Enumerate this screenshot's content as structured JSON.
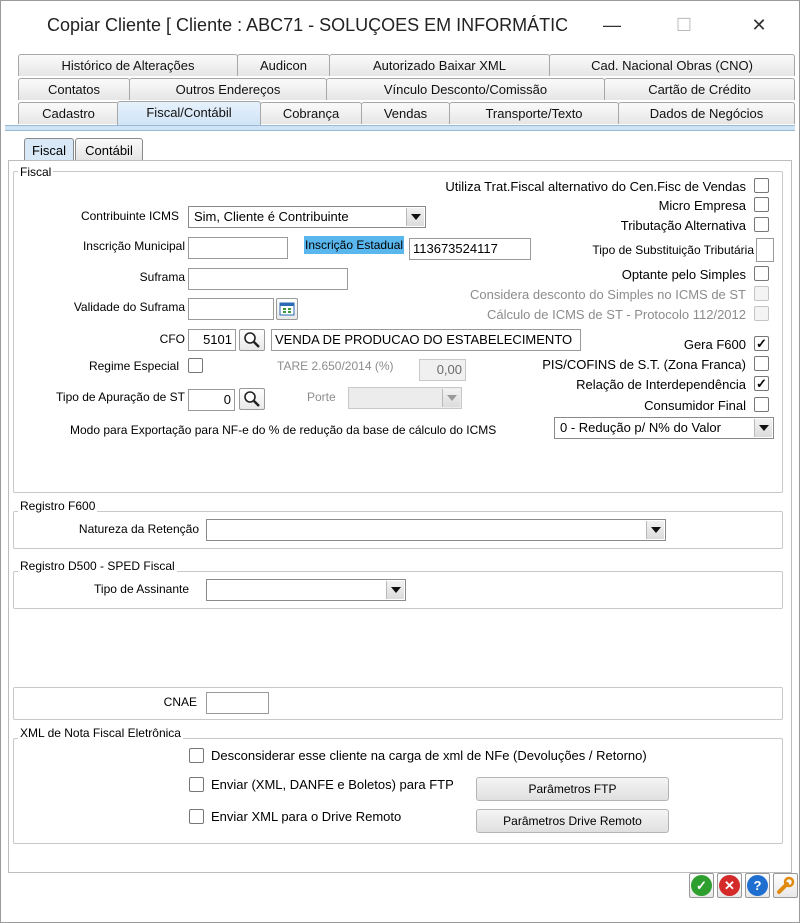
{
  "window": {
    "title": "Copiar Cliente [ Cliente : ABC71 - SOLUÇOES EM INFORMÁTIC...",
    "minimize_glyph": "—",
    "maximize_glyph": "☐",
    "close_glyph": "✕"
  },
  "tabs": {
    "row1": [
      "Histórico de Alterações",
      "Audicon",
      "Autorizado Baixar XML",
      "Cad. Nacional Obras (CNO)"
    ],
    "row2": [
      "Contatos",
      "Outros Endereços",
      "Vínculo Desconto/Comissão",
      "Cartão de Crédito"
    ],
    "row3": [
      "Cadastro",
      "Fiscal/Contábil",
      "Cobrança",
      "Vendas",
      "Transporte/Texto",
      "Dados de Negócios"
    ],
    "active": "Fiscal/Contábil"
  },
  "subtabs": {
    "fiscal": "Fiscal",
    "contabil": "Contábil"
  },
  "fiscal": {
    "group_title": "Fiscal",
    "contribuinte_label": "Contribuinte ICMS",
    "contribuinte_value": "Sim, Cliente é Contribuinte",
    "inscricao_municipal_label": "Inscrição Municipal",
    "inscricao_municipal_value": "",
    "inscricao_estadual_label": "Inscrição Estadual",
    "inscricao_estadual_value": "113673524117",
    "suframa_label": "Suframa",
    "suframa_value": "",
    "validade_suframa_label": "Validade do Suframa",
    "validade_suframa_value": "",
    "cfo_label": "CFO",
    "cfo_code": "5101",
    "cfo_desc": "VENDA DE PRODUCAO DO ESTABELECIMENTO",
    "regime_especial_label": "Regime Especial",
    "tare_label": "TARE 2.650/2014 (%)",
    "tare_value": "0,00",
    "tipo_apuracao_label": "Tipo de Apuração de ST",
    "tipo_apuracao_value": "0",
    "porte_label": "Porte",
    "modo_exportacao_label": "Modo para Exportação para NF-e do % de redução da base de cálculo do ICMS",
    "modo_exportacao_value": "0 - Redução p/ N% do Valor",
    "utiliza_trat_label": "Utiliza Trat.Fiscal alternativo do Cen.Fisc de Vendas",
    "micro_empresa_label": "Micro Empresa",
    "tributacao_alt_label": "Tributação Alternativa",
    "tipo_subst_label": "Tipo de Substituição Tributária",
    "optante_simples_label": "Optante pelo Simples",
    "considera_desconto_label": "Considera desconto do Simples no ICMS de ST",
    "calculo_icms_label": "Cálculo de ICMS de ST - Protocolo 112/2012",
    "gera_f600_label": "Gera F600",
    "pis_cofins_label": "PIS/COFINS de S.T. (Zona Franca)",
    "relacao_interdep_label": "Relação de Interdependência",
    "consumidor_final_label": "Consumidor Final",
    "check_mark": "✓"
  },
  "registro_f600": {
    "group_title": "Registro F600",
    "natureza_label": "Natureza da Retenção",
    "natureza_value": ""
  },
  "registro_d500": {
    "group_title": "Registro D500 - SPED Fiscal",
    "tipo_assinante_label": "Tipo de Assinante",
    "tipo_assinante_value": ""
  },
  "cnae": {
    "label": "CNAE",
    "value": ""
  },
  "xml_nfe": {
    "group_title": "XML de Nota Fiscal Eletrônica",
    "desconsiderar_label": "Desconsiderar esse cliente na carga de xml de NFe (Devoluções / Retorno)",
    "enviar_ftp_label": "Enviar (XML, DANFE e Boletos) para FTP",
    "enviar_drive_label": "Enviar XML para o Drive Remoto",
    "parametros_ftp_button": "Parâmetros FTP",
    "parametros_drive_button": "Parâmetros Drive Remoto"
  },
  "footer": {
    "ok_glyph": "✓",
    "cancel_glyph": "✕",
    "help_glyph": "?"
  },
  "colors": {
    "accent": "#cfe3f6",
    "highlight_label": "#5ab7ee",
    "ok": "#2e9e2e",
    "cancel": "#d42a2a",
    "help": "#1f6fd1",
    "tool": "#e08a10"
  }
}
